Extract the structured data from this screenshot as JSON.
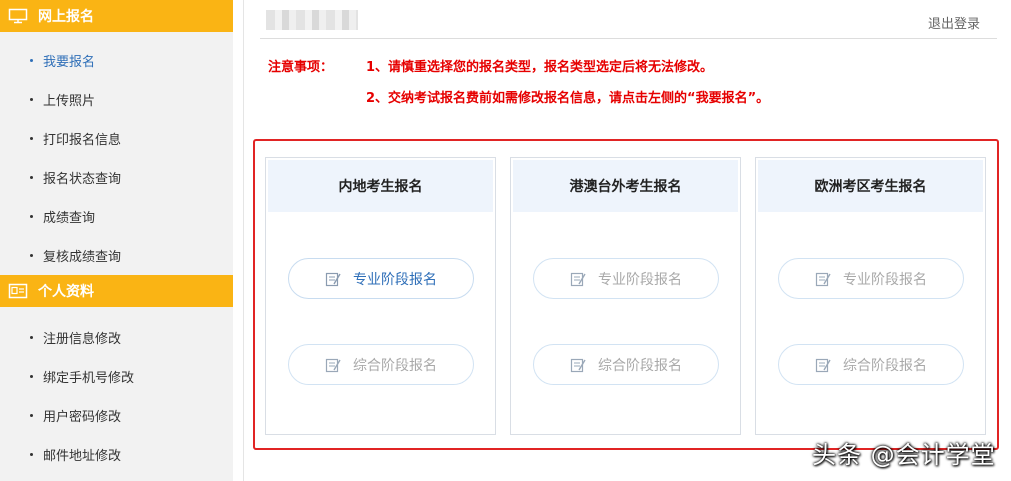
{
  "sidebar": {
    "section1": {
      "title": "网上报名",
      "icon": "monitor-icon",
      "items": [
        {
          "label": "我要报名",
          "active": true
        },
        {
          "label": "上传照片"
        },
        {
          "label": "打印报名信息"
        },
        {
          "label": "报名状态查询"
        },
        {
          "label": "成绩查询"
        },
        {
          "label": "复核成绩查询"
        }
      ]
    },
    "section2": {
      "title": "个人资料",
      "icon": "id-card-icon",
      "items": [
        {
          "label": "注册信息修改"
        },
        {
          "label": "绑定手机号修改"
        },
        {
          "label": "用户密码修改"
        },
        {
          "label": "邮件地址修改"
        }
      ]
    }
  },
  "header": {
    "logout": "退出登录"
  },
  "notice": {
    "label": "注意事项：",
    "items": [
      "1、请慎重选择您的报名类型，报名类型选定后将无法修改。",
      "2、交纳考试报名费前如需修改报名信息，请点击左侧的“我要报名”。"
    ]
  },
  "cards": [
    {
      "title": "内地考生报名",
      "buttons": [
        "专业阶段报名",
        "综合阶段报名"
      ],
      "first_enabled": true
    },
    {
      "title": "港澳台外考生报名",
      "buttons": [
        "专业阶段报名",
        "综合阶段报名"
      ],
      "first_enabled": false
    },
    {
      "title": "欧洲考区考生报名",
      "buttons": [
        "专业阶段报名",
        "综合阶段报名"
      ],
      "first_enabled": false
    }
  ],
  "watermark": "头条 @会计学堂",
  "colors": {
    "accent": "#fab414",
    "link": "#2f6fb8",
    "warning": "#e60000",
    "highlight_border": "#e12424"
  }
}
